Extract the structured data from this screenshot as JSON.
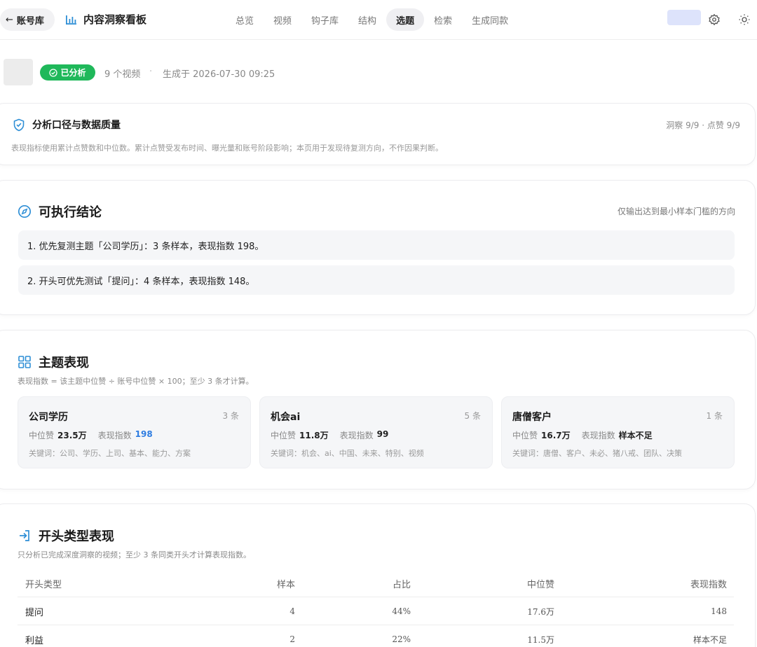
{
  "header": {
    "back_label": "账号库",
    "title": "内容洞察看板",
    "nav": [
      {
        "label": "总览",
        "active": false
      },
      {
        "label": "视频",
        "active": false
      },
      {
        "label": "钩子库",
        "active": false
      },
      {
        "label": "结构",
        "active": false
      },
      {
        "label": "选题",
        "active": true
      },
      {
        "label": "检索",
        "active": false
      },
      {
        "label": "生成同款",
        "active": false
      }
    ]
  },
  "meta": {
    "status": "已分析",
    "video_count": "9 个视频",
    "separator": "·",
    "generated": "生成于 2026-07-30 09:25"
  },
  "quality": {
    "title": "分析口径与数据质量",
    "stat": "洞察 9/9 · 点赞 9/9",
    "desc": "表现指标使用累计点赞数和中位数。累计点赞受发布时间、曝光量和账号阶段影响；本页用于发现待复测方向，不作因果判断。"
  },
  "conclusions": {
    "title": "可执行结论",
    "note": "仅输出达到最小样本门槛的方向",
    "items": [
      "1. 优先复测主题「公司学历」：3 条样本，表现指数 198。",
      "2. 开头可优先测试「提问」：4 条样本，表现指数 148。"
    ]
  },
  "topics": {
    "title": "主题表现",
    "desc": "表现指数 = 该主题中位赞 ÷ 账号中位赞 × 100；至少 3 条才计算。",
    "median_label": "中位赞",
    "index_label": "表现指数",
    "cards": [
      {
        "name": "公司学历",
        "count": "3 条",
        "median": "23.5万",
        "index": "198",
        "keywords": "关键词：公司、学历、上司、基本、能力、方案"
      },
      {
        "name": "机会ai",
        "count": "5 条",
        "median": "11.8万",
        "index": "99",
        "keywords": "关键词：机会、ai、中国、未来、特别、视频"
      },
      {
        "name": "唐僧客户",
        "count": "1 条",
        "median": "16.7万",
        "index": "样本不足",
        "keywords": "关键词：唐僧、客户、未必、猪八戒、团队、决策"
      }
    ]
  },
  "openings": {
    "title": "开头类型表现",
    "desc": "只分析已完成深度洞察的视频；至少 3 条同类开头才计算表现指数。",
    "columns": [
      "开头类型",
      "样本",
      "占比",
      "中位赞",
      "表现指数"
    ],
    "rows": [
      [
        "提问",
        "4",
        "44%",
        "17.6万",
        "148"
      ],
      [
        "利益",
        "2",
        "22%",
        "11.5万",
        "样本不足"
      ]
    ]
  },
  "colors": {
    "accent_green": "#1fb85a",
    "accent_blue": "#2f7de1",
    "icon_blue": "#2f8fd6"
  }
}
